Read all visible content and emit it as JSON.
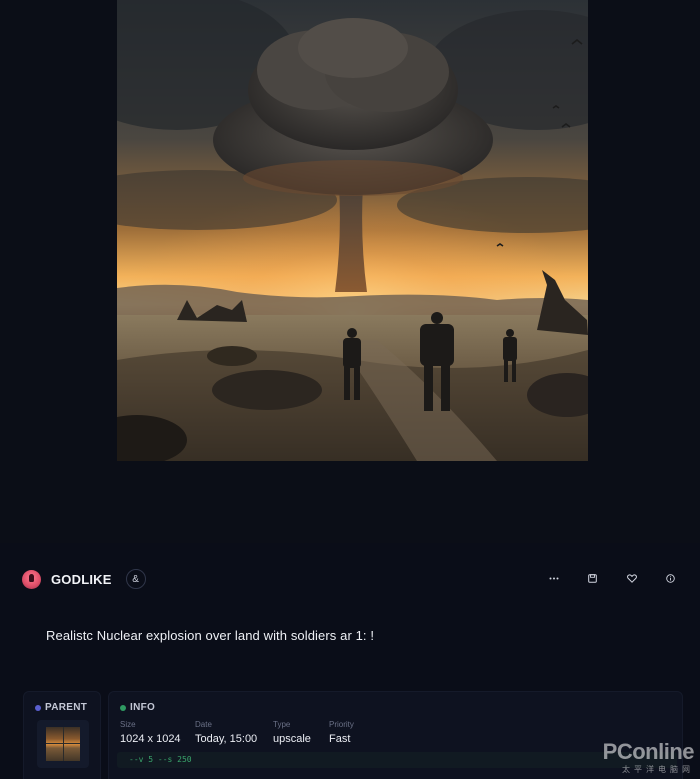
{
  "image": {
    "alt": "Realistc Nuclear explosion over land with soldiers ar 1: !"
  },
  "user": {
    "name": "GODLIKE",
    "badge_icon": "ampersand-icon"
  },
  "actions": [
    {
      "icon": "more-icon"
    },
    {
      "icon": "save-icon"
    },
    {
      "icon": "heart-icon"
    },
    {
      "icon": "info-icon"
    }
  ],
  "prompt": "Realistc Nuclear explosion over land with soldiers ar 1: !",
  "parent": {
    "title": "PARENT"
  },
  "info": {
    "title": "INFO",
    "size_label": "Size",
    "size_value": "1024 x 1024",
    "date_label": "Date",
    "date_value": "Today, 15:00",
    "type_label": "Type",
    "type_value": "upscale",
    "priority_label": "Priority",
    "priority_value": "Fast",
    "params": "--v 5 --s 250"
  },
  "watermark": {
    "main": "PConline",
    "sub": "太平洋电脑网"
  },
  "colors": {
    "background": "#0b0e17",
    "panel": "#0a0d18",
    "accent_green": "#2f9a62",
    "accent_purple": "#5a5fcf"
  }
}
